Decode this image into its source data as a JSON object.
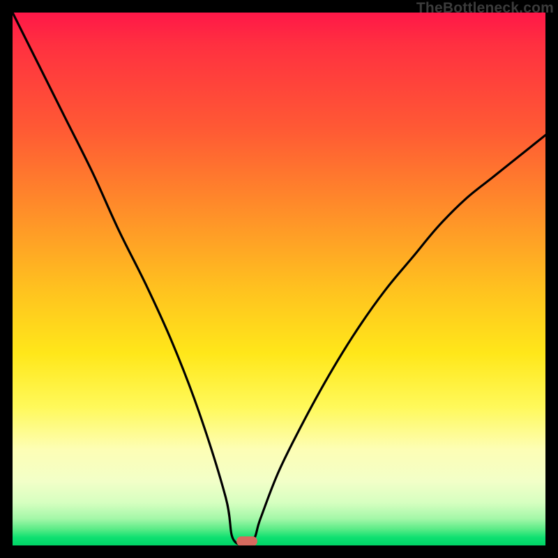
{
  "watermark": "TheBottleneck.com",
  "marker": {
    "x_pct": 44.0,
    "y_pct": 99.0
  },
  "chart_data": {
    "type": "line",
    "title": "",
    "xlabel": "",
    "ylabel": "",
    "xlim": [
      0,
      100
    ],
    "ylim": [
      0,
      100
    ],
    "grid": false,
    "legend": false,
    "series": [
      {
        "name": "bottleneck-curve",
        "x": [
          0,
          5,
          10,
          15,
          20,
          25,
          30,
          35,
          40,
          41.5,
          45,
          46.5,
          50,
          55,
          60,
          65,
          70,
          75,
          80,
          85,
          90,
          95,
          100
        ],
        "y": [
          100,
          90,
          80,
          70,
          59,
          49,
          38,
          25,
          9,
          1,
          1,
          5,
          14,
          24,
          33,
          41,
          48,
          54,
          60,
          65,
          69,
          73,
          77
        ]
      }
    ],
    "annotations": [
      {
        "type": "marker",
        "x": 44,
        "y": 1,
        "shape": "pill",
        "color": "#d66a5e"
      }
    ],
    "background_gradient": {
      "direction": "vertical",
      "stops": [
        {
          "pct": 0,
          "color": "#ff1748"
        },
        {
          "pct": 36,
          "color": "#ff8a2a"
        },
        {
          "pct": 64,
          "color": "#ffe71a"
        },
        {
          "pct": 88,
          "color": "#f2ffc8"
        },
        {
          "pct": 100,
          "color": "#00d566"
        }
      ]
    }
  }
}
